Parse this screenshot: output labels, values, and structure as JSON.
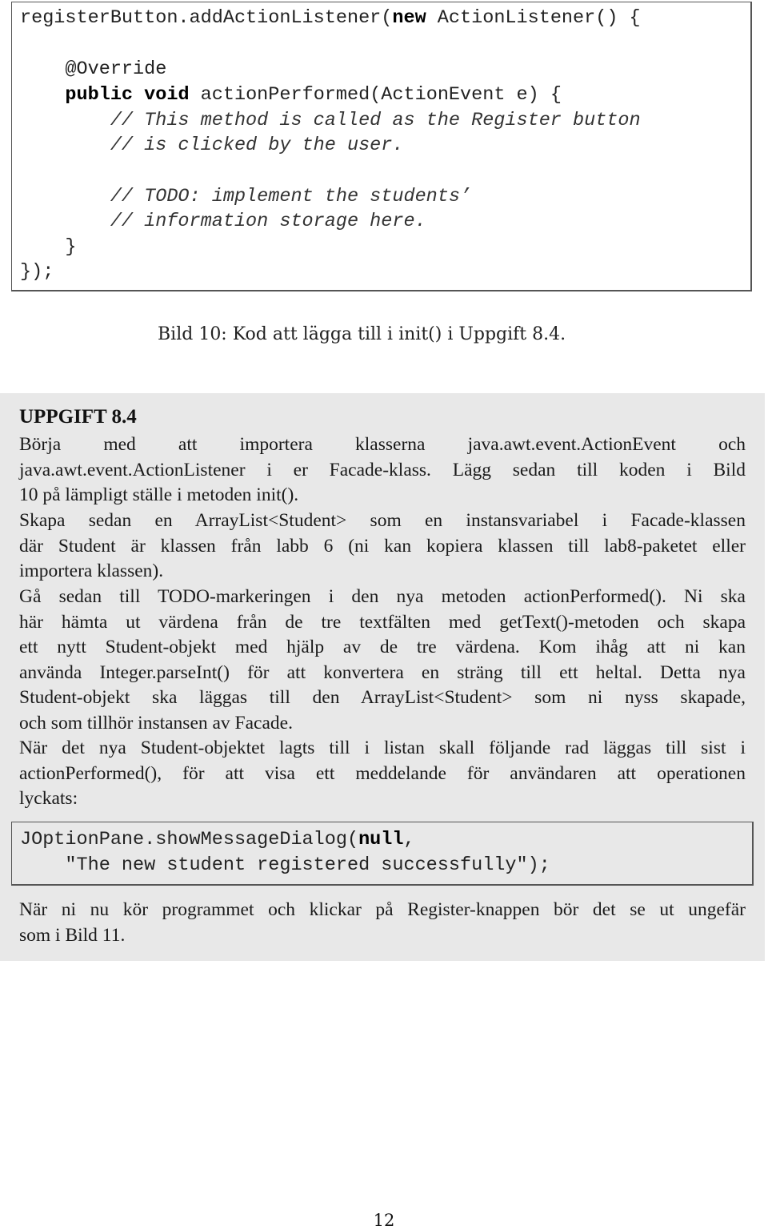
{
  "code_listing": {
    "lines": [
      {
        "pre": "registerButton.addActionListener(",
        "kw": "new",
        "post": " ActionListener() {"
      },
      {
        "pre": "",
        "kw": "",
        "post": ""
      },
      {
        "pre": "    @Override",
        "kw": "",
        "post": ""
      },
      {
        "pre": "    ",
        "kw": "public void",
        "post": " actionPerformed(ActionEvent e) {"
      },
      {
        "comment": "        // This method is called as the Register button"
      },
      {
        "comment": "        // is clicked by the user."
      },
      {
        "pre": "",
        "kw": "",
        "post": ""
      },
      {
        "comment": "        // TODO: implement the students’"
      },
      {
        "comment": "        // information storage here."
      },
      {
        "pre": "    }",
        "kw": "",
        "post": ""
      },
      {
        "pre": "});",
        "kw": "",
        "post": ""
      }
    ]
  },
  "figure_caption": "Bild 10: Kod att lägga till i init() i Uppgift 8.4.",
  "task": {
    "title": "UPPGIFT 8.4",
    "paragraph1_lines": [
      " Börja med att importera klasserna java.awt.event.ActionEvent och",
      "java.awt.event.ActionListener i er Facade-klass.  Lägg sedan till koden i Bild",
      "10 på lämpligt ställe i metoden init()."
    ],
    "paragraph2_lines": [
      "Skapa sedan en ArrayList<Student> som en instansvariabel i Facade-klassen",
      "där Student är klassen från labb 6 (ni kan kopiera klassen till lab8-paketet eller",
      "importera klassen)."
    ],
    "paragraph3_lines": [
      "Gå sedan till TODO-markeringen i den nya metoden actionPerformed(). Ni ska",
      "här hämta ut värdena från de tre textfälten med getText()-metoden och skapa",
      "ett nytt Student-objekt med hjälp av de tre värdena.  Kom ihåg att ni kan",
      "använda Integer.parseInt() för att konvertera en sträng till ett heltal. Detta nya",
      "Student-objekt ska läggas till den ArrayList<Student> som ni nyss skapade,",
      "och som tillhör instansen av Facade."
    ],
    "paragraph4_lines": [
      "När det nya Student-objektet lagts till i listan skall följande rad läggas till sist i",
      "actionPerformed(), för att visa ett meddelande för användaren att operationen",
      "lyckats:"
    ],
    "snippet": {
      "line1_pre": "JOptionPane.showMessageDialog(",
      "line1_kw": "null",
      "line1_post": ",",
      "line2": "    \"The new student registered successfully\");"
    },
    "paragraph5_lines": [
      "När ni nu kör programmet och klickar på Register-knappen bör det se ut ungefär",
      "som i Bild 11."
    ]
  },
  "page_number": "12"
}
